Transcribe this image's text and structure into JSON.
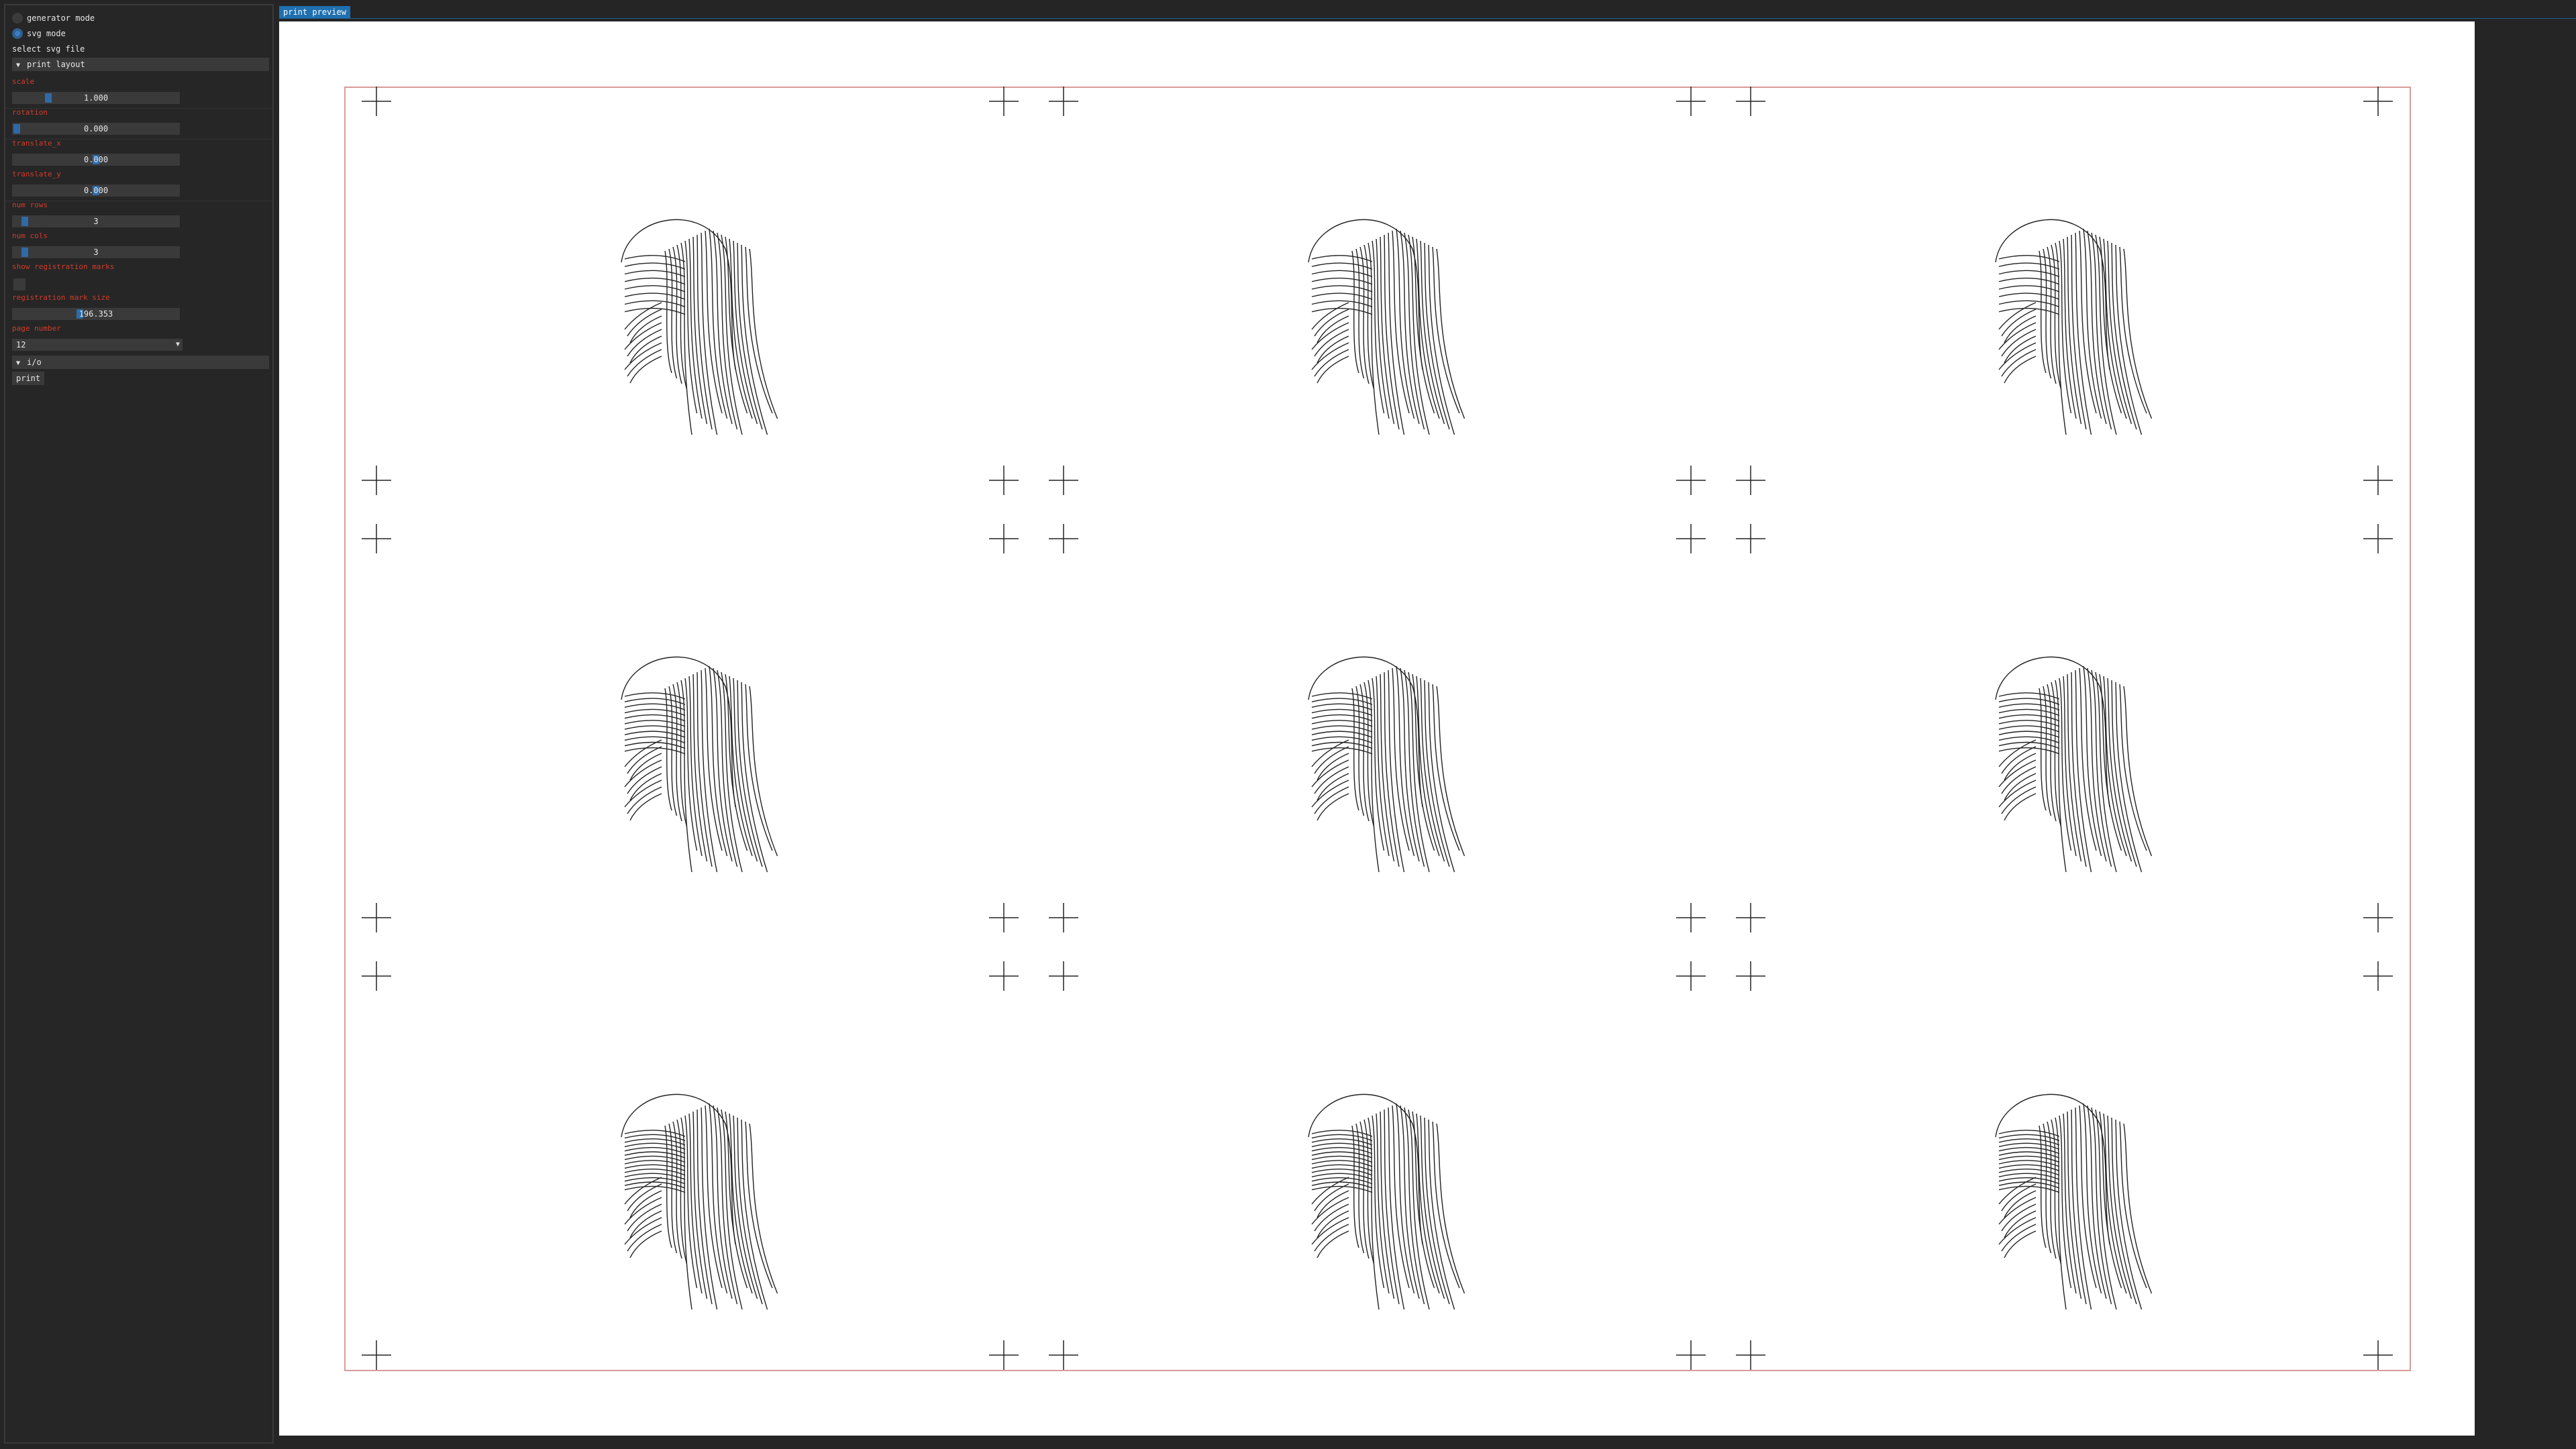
{
  "sidebar": {
    "generator_mode_label": "generator mode",
    "svg_mode_label": "svg mode",
    "select_file_button": "select svg file",
    "print_layout_header": "print layout",
    "params": {
      "scale_label": "scale",
      "scale_value": "1.000",
      "rotation_label": "rotation",
      "rotation_value": "0.000",
      "translate_x_label": "translate_x",
      "translate_x_value": "0.000",
      "translate_y_label": "translate_y",
      "translate_y_value": "0.000",
      "num_rows_label": "num rows",
      "num_rows_value": "3",
      "num_cols_label": "num cols",
      "num_cols_value": "3",
      "show_marks_label": "show registration marks",
      "mark_size_label": "registration mark size",
      "mark_size_value": "196.353",
      "page_number_label": "page number",
      "page_number_value": "12"
    },
    "io_header": "i/o",
    "print_button": "print"
  },
  "preview": {
    "tab_label": "print preview",
    "grid_rows": 3,
    "grid_cols": 3
  },
  "colors": {
    "accent": "#1f70b0",
    "param_label": "#d23b2b",
    "border": "#d99a9a"
  },
  "icons": {
    "collapse": "triangle-down-icon",
    "dropdown": "chevron-down-icon",
    "registration_mark": "crosshair-icon"
  }
}
